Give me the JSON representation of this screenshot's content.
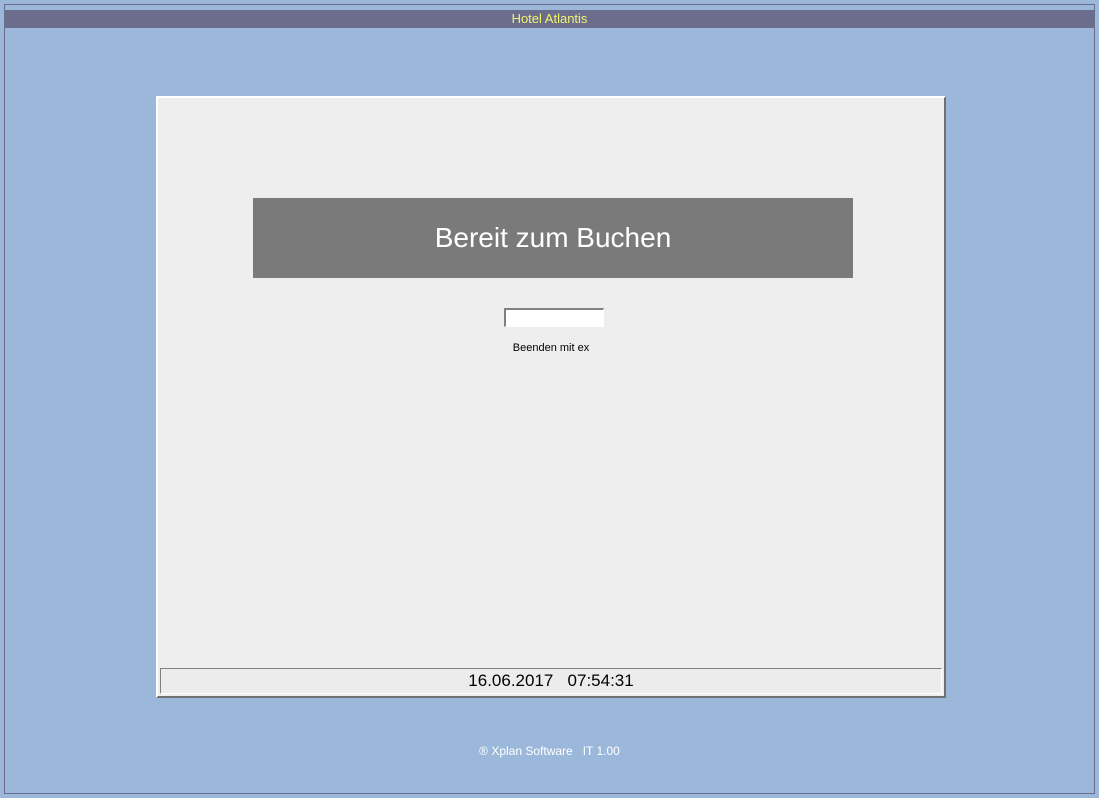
{
  "header": {
    "title": "Hotel Atlantis"
  },
  "main": {
    "banner": "Bereit zum Buchen",
    "input_value": "",
    "input_hint": "Beenden mit ex",
    "status_datetime": "16.06.2017   07:54:31"
  },
  "footer": {
    "credit": "® Xplan Software   IT 1.00"
  }
}
